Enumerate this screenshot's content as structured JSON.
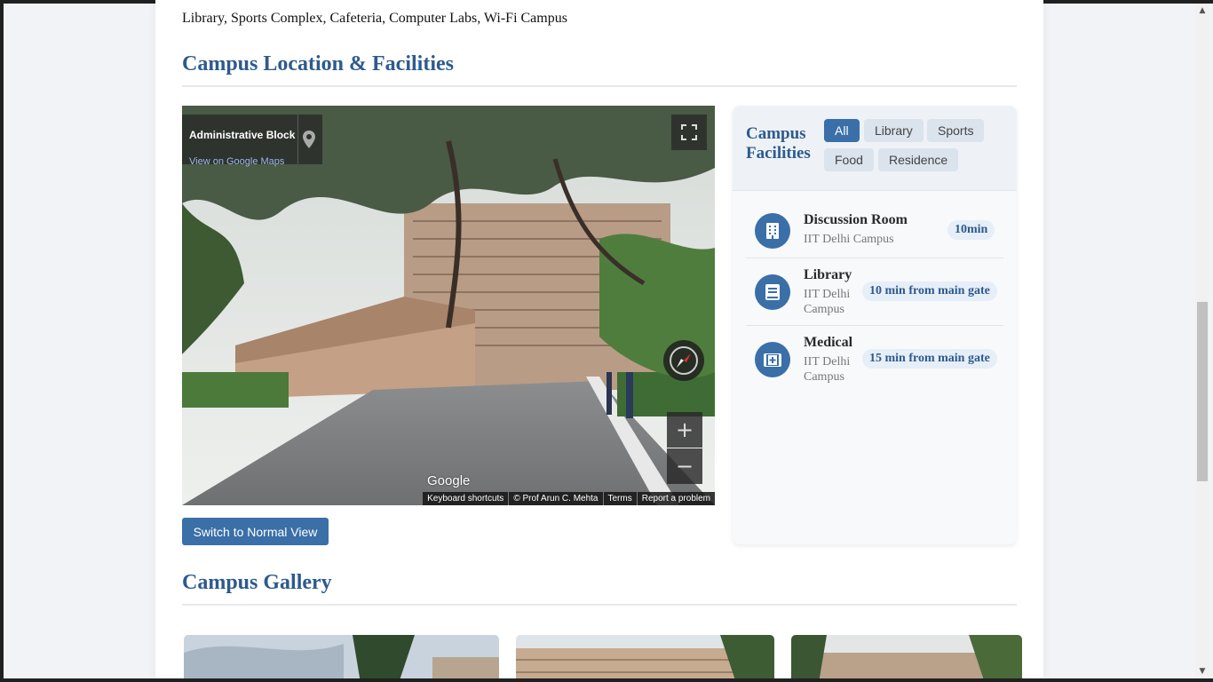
{
  "intro": {
    "facilities_text": "Library, Sports Complex, Cafeteria, Computer Labs, Wi-Fi Campus"
  },
  "location_section": {
    "title": "Campus Location & Facilities",
    "streetview": {
      "place_name": "Administrative Block",
      "maps_link": "View on Google Maps",
      "logo": "Google",
      "zoom_in": "+",
      "zoom_out": "−",
      "attribution": [
        "Keyboard shortcuts",
        "© Prof Arun C. Mehta",
        "Terms",
        "Report a problem"
      ]
    },
    "switch_button": "Switch to Normal View"
  },
  "facilities_panel": {
    "title": "Campus Facilities",
    "filters": [
      "All",
      "Library",
      "Sports",
      "Food",
      "Residence"
    ],
    "active_filter": "All",
    "items": [
      {
        "name": "Discussion Room",
        "location": "IIT Delhi Campus",
        "time": "10min",
        "icon": "building-icon"
      },
      {
        "name": "Library",
        "location": "IIT Delhi Campus",
        "time": "10 min from main gate",
        "icon": "book-icon"
      },
      {
        "name": "Medical",
        "location": "IIT Delhi Campus",
        "time": "15 min from main gate",
        "icon": "medical-kit-icon"
      }
    ],
    "accent_color": "#3a6fa8"
  },
  "gallery_section": {
    "title": "Campus Gallery"
  },
  "colors": {
    "heading": "#2d5a8e",
    "button": "#3a6fa8"
  }
}
